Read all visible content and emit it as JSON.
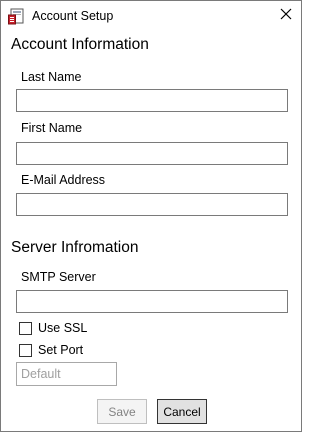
{
  "window": {
    "title": "Account Setup",
    "app_icon": "account-setup-app-icon",
    "close_icon": "close-icon"
  },
  "account_section": {
    "heading": "Account Information",
    "last_name": {
      "label": "Last Name",
      "value": "",
      "placeholder": ""
    },
    "first_name": {
      "label": "First Name",
      "value": "",
      "placeholder": ""
    },
    "email": {
      "label": "E-Mail Address",
      "value": "",
      "placeholder": ""
    }
  },
  "server_section": {
    "heading": "Server Infromation",
    "smtp_server": {
      "label": "SMTP Server",
      "value": "",
      "placeholder": ""
    },
    "use_ssl": {
      "label": "Use SSL",
      "checked": false
    },
    "set_port": {
      "label": "Set Port",
      "checked": false
    },
    "port": {
      "value": "",
      "placeholder": "Default"
    }
  },
  "buttons": {
    "save_label": "Save",
    "save_enabled": false,
    "cancel_label": "Cancel"
  },
  "colors": {
    "input_border": "#7a7a7a",
    "disabled_text": "#838383",
    "button_face": "#e1e1e1",
    "icon_red": "#c8202a"
  }
}
